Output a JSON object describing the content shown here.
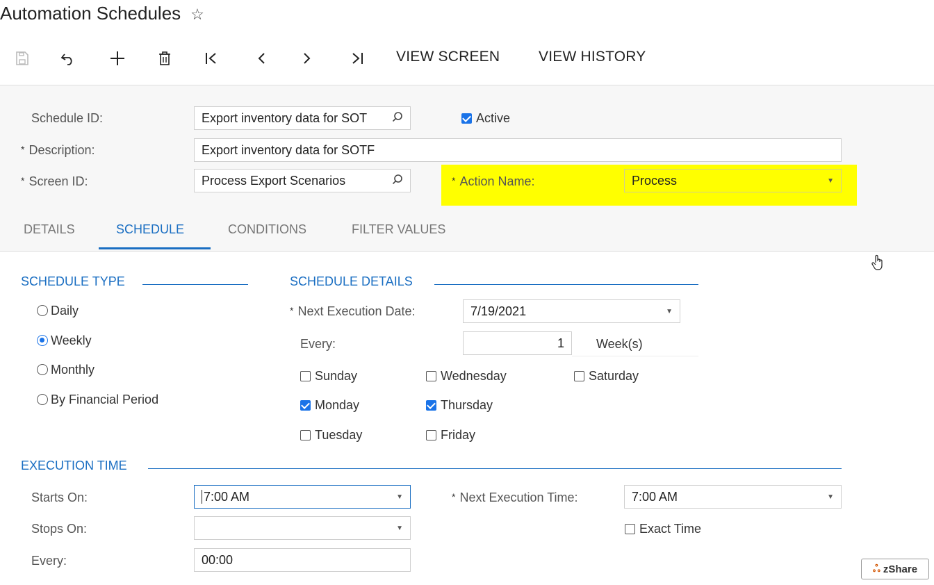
{
  "page": {
    "title": "Automation Schedules"
  },
  "toolbar": {
    "view_screen": "VIEW SCREEN",
    "view_history": "VIEW HISTORY"
  },
  "form": {
    "schedule_id_label": "Schedule ID:",
    "schedule_id_value": "Export inventory data for SOT",
    "active_label": "Active",
    "active_checked": true,
    "description_label": "Description:",
    "description_value": "Export inventory data for SOTF",
    "screen_id_label": "Screen ID:",
    "screen_id_value": "Process Export Scenarios",
    "action_name_label": "Action Name:",
    "action_name_value": "Process",
    "highlight_color": "#ffff00"
  },
  "tabs": [
    {
      "label": "DETAILS",
      "active": false
    },
    {
      "label": "SCHEDULE",
      "active": true
    },
    {
      "label": "CONDITIONS",
      "active": false
    },
    {
      "label": "FILTER VALUES",
      "active": false
    }
  ],
  "schedule_type": {
    "heading": "SCHEDULE TYPE",
    "options": [
      {
        "label": "Daily",
        "selected": false
      },
      {
        "label": "Weekly",
        "selected": true
      },
      {
        "label": "Monthly",
        "selected": false
      },
      {
        "label": "By Financial Period",
        "selected": false
      }
    ]
  },
  "schedule_details": {
    "heading": "SCHEDULE DETAILS",
    "next_date_label": "Next Execution Date:",
    "next_date_value": "7/19/2021",
    "every_label": "Every:",
    "every_value": "1",
    "every_unit": "Week(s)",
    "days": {
      "sunday": {
        "label": "Sunday",
        "checked": false
      },
      "monday": {
        "label": "Monday",
        "checked": true
      },
      "tuesday": {
        "label": "Tuesday",
        "checked": false
      },
      "wednesday": {
        "label": "Wednesday",
        "checked": false
      },
      "thursday": {
        "label": "Thursday",
        "checked": true
      },
      "friday": {
        "label": "Friday",
        "checked": false
      },
      "saturday": {
        "label": "Saturday",
        "checked": false
      }
    }
  },
  "execution_time": {
    "heading": "EXECUTION TIME",
    "starts_on_label": "Starts On:",
    "starts_on_value": "7:00 AM",
    "stops_on_label": "Stops On:",
    "stops_on_value": "",
    "every_label": "Every:",
    "every_value": "00:00",
    "next_time_label": "Next Execution Time:",
    "next_time_value": "7:00 AM",
    "exact_time_label": "Exact Time",
    "exact_time_checked": false
  },
  "accent_color": "#1a6ec2",
  "badge": {
    "label": "zShare"
  }
}
